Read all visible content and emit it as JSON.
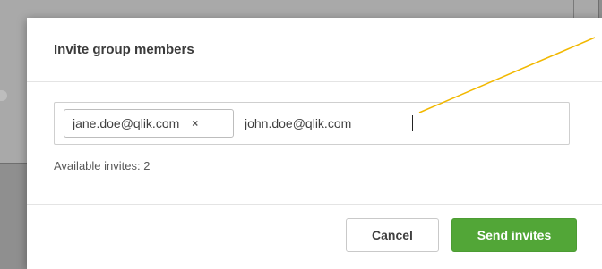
{
  "dialog": {
    "title": "Invite group members",
    "chips": [
      {
        "label": "jane.doe@qlik.com",
        "remove_icon": "×"
      }
    ],
    "input_value": "john.doe@qlik.com",
    "available_invites": "Available invites: 2",
    "cancel_label": "Cancel",
    "send_label": "Send invites"
  },
  "colors": {
    "primary": "#52a637",
    "annotation_line": "#f2b800",
    "overlay": "#8f8f8f"
  },
  "icons": {
    "chip_remove": "close-icon"
  }
}
